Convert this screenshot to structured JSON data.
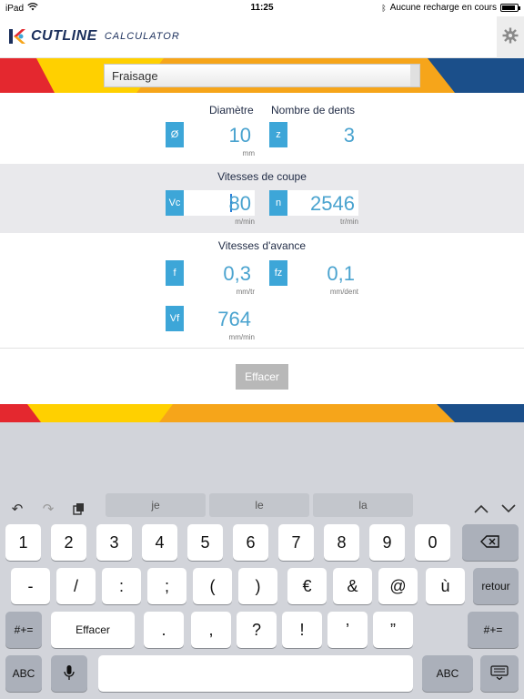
{
  "status": {
    "device": "iPad",
    "time": "11:25",
    "charge": "Aucune recharge en cours"
  },
  "app": {
    "logo_text": "CUTLINE",
    "logo_sub": "CALCULATOR",
    "icons": {
      "settings": "gear-icon"
    }
  },
  "mode": {
    "value": "Fraisage"
  },
  "sections": {
    "tool": {
      "diametre_label": "Diamètre",
      "dents_label": "Nombre de dents",
      "diametre": {
        "tag": "Ø",
        "value": "10",
        "unit": "mm"
      },
      "dents": {
        "tag": "z",
        "value": "3"
      }
    },
    "coupe": {
      "title": "Vitesses de coupe",
      "vc": {
        "tag": "Vc",
        "value": "80",
        "unit": "m/min"
      },
      "n": {
        "tag": "n",
        "value": "2546",
        "unit": "tr/min"
      }
    },
    "avance": {
      "title": "Vitesses d'avance",
      "f": {
        "tag": "f",
        "value": "0,3",
        "unit": "mm/tr"
      },
      "fz": {
        "tag": "fz",
        "value": "0,1",
        "unit": "mm/dent"
      },
      "vf": {
        "tag": "Vf",
        "value": "764",
        "unit": "mm/min"
      }
    }
  },
  "actions": {
    "clear_label": "Effacer"
  },
  "keyboard": {
    "suggestions": [
      "je",
      "le",
      "la"
    ],
    "row1": [
      "1",
      "2",
      "3",
      "4",
      "5",
      "6",
      "7",
      "8",
      "9",
      "0"
    ],
    "row2": [
      "-",
      "/",
      ":",
      ";",
      "(",
      ")",
      "€",
      "&",
      "@",
      "ù"
    ],
    "return_label": "retour",
    "row3": [
      ".",
      ",",
      "?",
      "!",
      "’",
      "”"
    ],
    "symbols_label": "#+=",
    "erase_label": "Effacer",
    "abc_label": "ABC",
    "colors": {
      "accent": "#3da6d8",
      "value": "#4aa3cf",
      "navy": "#1b2f5c"
    }
  }
}
